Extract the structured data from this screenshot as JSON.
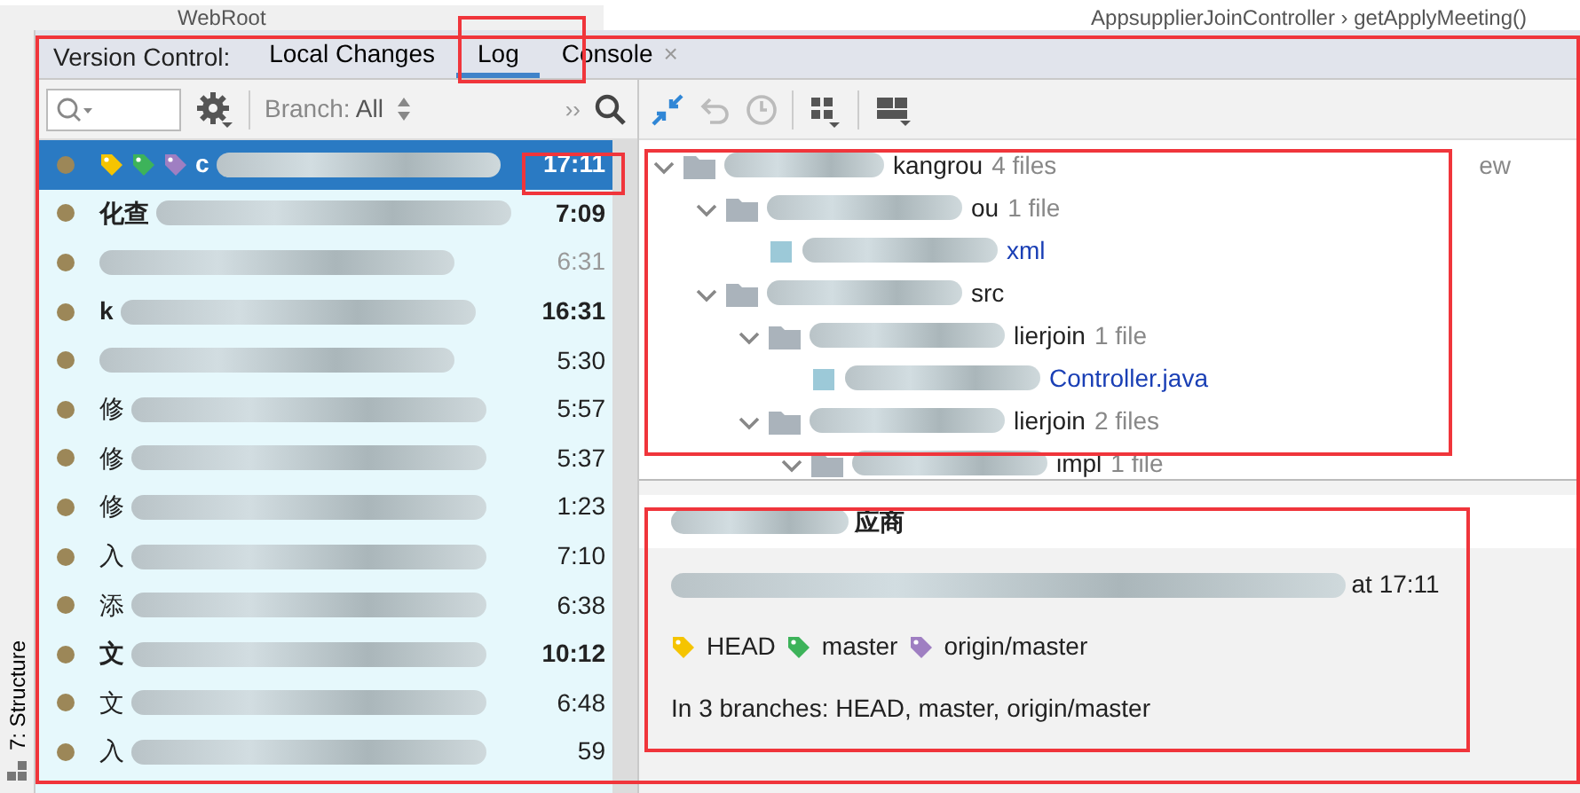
{
  "top_strip": {
    "left_text": "WebRoot",
    "right_text": "AppsupplierJoinController › getApplyMeeting()"
  },
  "side_tool": {
    "label": "7: Structure"
  },
  "tool_window": {
    "title": "Version Control:",
    "tabs": [
      {
        "label": "Local Changes",
        "selected": false
      },
      {
        "label": "Log",
        "selected": true
      },
      {
        "label": "Console",
        "selected": false,
        "close_glyph": "×"
      }
    ]
  },
  "log_toolbar": {
    "branch_label": "Branch:",
    "branch_value": "All",
    "more": "››"
  },
  "commits": [
    {
      "message": "c",
      "time": "17:11",
      "selected": true,
      "bold": true,
      "faded": false,
      "tags": [
        {
          "color": "#f5c400"
        },
        {
          "color": "#3db35a"
        },
        {
          "color": "#9f7fc2"
        }
      ]
    },
    {
      "message": "化查",
      "time": "7:09",
      "selected": false,
      "bold": true,
      "faded": false
    },
    {
      "time": "6:31",
      "selected": false,
      "bold": false,
      "faded": true
    },
    {
      "message": "k",
      "time": "16:31",
      "selected": false,
      "bold": true,
      "faded": false
    },
    {
      "time": "5:30",
      "selected": false,
      "bold": false,
      "faded": false
    },
    {
      "message": "修",
      "time": "5:57",
      "selected": false,
      "bold": false,
      "faded": false
    },
    {
      "message": "修",
      "time": "5:37",
      "selected": false,
      "bold": false,
      "faded": false
    },
    {
      "message": "修",
      "time": "1:23",
      "selected": false,
      "bold": false,
      "faded": false
    },
    {
      "message": "入",
      "time": "7:10",
      "selected": false,
      "bold": false,
      "faded": false
    },
    {
      "message": "添",
      "time": "6:38",
      "selected": false,
      "bold": false,
      "faded": false
    },
    {
      "message": "文",
      "time": "10:12",
      "selected": false,
      "bold": true,
      "faded": false
    },
    {
      "message": "文",
      "time": "6:48",
      "selected": false,
      "bold": false,
      "faded": false
    },
    {
      "message": "入",
      "time": "59",
      "selected": false,
      "bold": false,
      "faded": false
    }
  ],
  "changes_tree": [
    {
      "kind": "folder",
      "name": "kangrou",
      "count": "4 files",
      "note": "ew",
      "expanded": true,
      "children": [
        {
          "kind": "folder",
          "name": "ou",
          "count": "1 file",
          "expanded": true,
          "children": [
            {
              "kind": "file",
              "name": "xml"
            }
          ]
        },
        {
          "kind": "folder",
          "name": "src",
          "expanded": true,
          "children": [
            {
              "kind": "folder",
              "name": "lierjoin",
              "count": "1 file",
              "expanded": true,
              "children": [
                {
                  "kind": "file",
                  "name": "Controller.java"
                }
              ]
            },
            {
              "kind": "folder",
              "name": "lierjoin",
              "count": "2 files",
              "expanded": true,
              "children": [
                {
                  "kind": "folder",
                  "name": "impl",
                  "count": "1 file",
                  "expanded": true
                }
              ]
            }
          ]
        }
      ]
    }
  ],
  "details": {
    "subject": "应商",
    "author_line": "at 17:11",
    "refs": [
      {
        "name": "HEAD",
        "color": "#f5c400"
      },
      {
        "name": "master",
        "color": "#3db35a"
      },
      {
        "name": "origin/master",
        "color": "#9f7fc2"
      }
    ],
    "branches": "In 3 branches: HEAD, master, origin/master"
  }
}
